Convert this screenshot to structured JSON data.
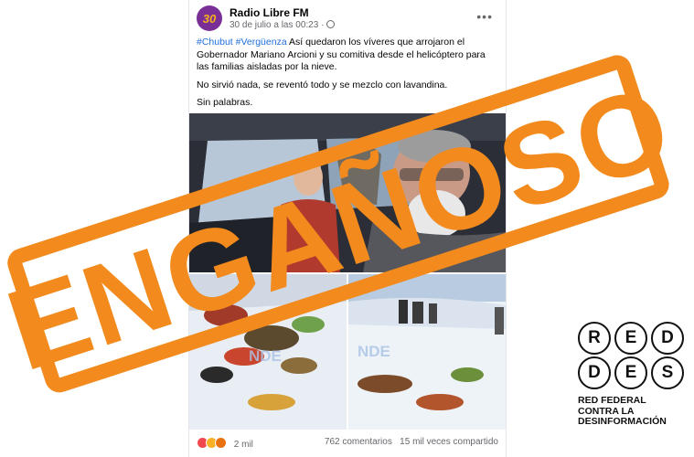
{
  "post": {
    "page_name": "Radio Libre FM",
    "avatar_text": "30",
    "timestamp": "30 de julio a las 00:23 ·",
    "hashtags": "#Chubut #Vergüenza",
    "text_main": " Así quedaron los víveres que arrojaron el Gobernador Mariano Arcioni y su comitiva desde el helicóptero para las familias aisladas por la nieve.",
    "text_2": "No sirvió nada, se reventó todo y se mezclo con lavandina.",
    "text_3": "Sin palabras.",
    "watermark": "NDE",
    "reactions_count": "2 mil",
    "comments": "762 comentarios",
    "shares": "15 mil veces compartido"
  },
  "stamp": {
    "label": "ENGAÑOSO",
    "color": "#f28a1d"
  },
  "logo": {
    "row1": [
      "R",
      "E",
      "D"
    ],
    "row2": [
      "D",
      "E",
      "S"
    ],
    "caption1": "RED FEDERAL",
    "caption2": "CONTRA LA",
    "caption3": "DESINFORMACIÓN"
  },
  "colors": {
    "link": "#216fdb",
    "muted": "#65676b",
    "orange": "#f28a1d"
  },
  "icons": [
    "more-icon",
    "globe-icon",
    "reaction-icons"
  ]
}
